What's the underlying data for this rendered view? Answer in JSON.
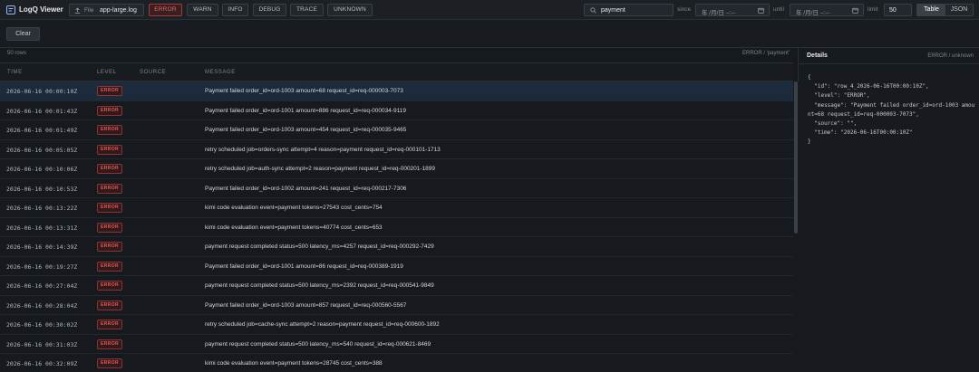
{
  "app": {
    "title": "LogQ Viewer"
  },
  "file": {
    "label": "File",
    "name": "app-large.log"
  },
  "levels": [
    "ERROR",
    "WARN",
    "INFO",
    "DEBUG",
    "TRACE",
    "UNKNOWN"
  ],
  "active_level": "ERROR",
  "search": {
    "value": "payment"
  },
  "since": {
    "label": "since",
    "value": "年 /月/日 --:--"
  },
  "until": {
    "label": "until",
    "value": "年 /月/日 --:--"
  },
  "limit": {
    "label": "limit",
    "value": "50"
  },
  "view_toggle": {
    "table": "Table",
    "json": "JSON",
    "active": "Table"
  },
  "toolbar": {
    "clear_label": "Clear"
  },
  "table": {
    "rows_count": "50 rows",
    "filter_summary": "ERROR / 'payment'",
    "columns": {
      "time": "TIME",
      "level": "LEVEL",
      "source": "SOURCE",
      "message": "MESSAGE"
    },
    "rows": [
      {
        "time": "2026-06-16 00:00:10Z",
        "level": "ERROR",
        "source": "",
        "message": "Payment failed order_id=ord-1003 amount=68 request_id=req-000003-7073"
      },
      {
        "time": "2026-06-16 00:01:43Z",
        "level": "ERROR",
        "source": "",
        "message": "Payment failed order_id=ord-1001 amount=886 request_id=req-000034-9119"
      },
      {
        "time": "2026-06-16 00:01:49Z",
        "level": "ERROR",
        "source": "",
        "message": "Payment failed order_id=ord-1003 amount=454 request_id=req-000035-9465"
      },
      {
        "time": "2026-06-16 00:05:05Z",
        "level": "ERROR",
        "source": "",
        "message": "retry scheduled job=orders-sync attempt=4 reason=payment request_id=req-000101-1713"
      },
      {
        "time": "2026-06-16 00:10:06Z",
        "level": "ERROR",
        "source": "",
        "message": "retry scheduled job=auth-sync attempt=2 reason=payment request_id=req-000201-1899"
      },
      {
        "time": "2026-06-16 00:10:53Z",
        "level": "ERROR",
        "source": "",
        "message": "Payment failed order_id=ord-1002 amount=241 request_id=req-000217-7306"
      },
      {
        "time": "2026-06-16 00:13:22Z",
        "level": "ERROR",
        "source": "",
        "message": "kimi code evaluation event=payment tokens=27543 cost_cents=754"
      },
      {
        "time": "2026-06-16 00:13:31Z",
        "level": "ERROR",
        "source": "",
        "message": "kimi code evaluation event=payment tokens=40774 cost_cents=653"
      },
      {
        "time": "2026-06-16 00:14:39Z",
        "level": "ERROR",
        "source": "",
        "message": "payment request completed status=500 latency_ms=4257 request_id=req-000292-7429"
      },
      {
        "time": "2026-06-16 00:19:27Z",
        "level": "ERROR",
        "source": "",
        "message": "Payment failed order_id=ord-1001 amount=86 request_id=req-000389-1919"
      },
      {
        "time": "2026-06-16 00:27:04Z",
        "level": "ERROR",
        "source": "",
        "message": "payment request completed status=500 latency_ms=2392 request_id=req-000541-9849"
      },
      {
        "time": "2026-06-16 00:28:04Z",
        "level": "ERROR",
        "source": "",
        "message": "Payment failed order_id=ord-1003 amount=857 request_id=req-000560-5567"
      },
      {
        "time": "2026-06-16 00:30:02Z",
        "level": "ERROR",
        "source": "",
        "message": "retry scheduled job=cache-sync attempt=2 reason=payment request_id=req-000600-1892"
      },
      {
        "time": "2026-06-16 00:31:03Z",
        "level": "ERROR",
        "source": "",
        "message": "payment request completed status=500 latency_ms=540 request_id=req-000621-8469"
      },
      {
        "time": "2026-06-16 00:32:09Z",
        "level": "ERROR",
        "source": "",
        "message": "kimi code evaluation event=payment tokens=28745 cost_cents=388"
      }
    ]
  },
  "details": {
    "title": "Details",
    "subtitle": "ERROR / unknown",
    "json": "{\n  \"id\": \"row_4_2026-06-16T00:00:10Z\",\n  \"level\": \"ERROR\",\n  \"message\": \"Payment failed order_id=ord-1003 amount=68 request_id=req-000003-7073\",\n  \"source\": \"\",\n  \"time\": \"2026-06-16T00:00:10Z\"\n}"
  },
  "colors": {
    "accent_error": "#e0595b",
    "selected_row": "#1b2b3c",
    "background": "#16191d"
  }
}
